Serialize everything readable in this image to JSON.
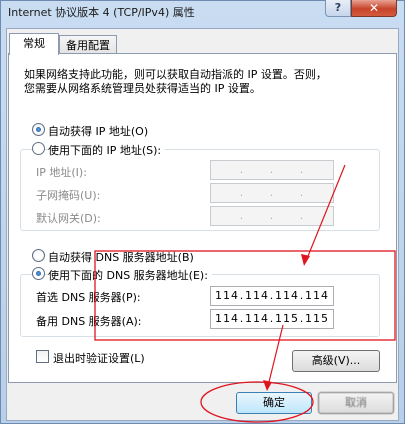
{
  "window": {
    "title": "Internet 协议版本 4 (TCP/IPv4) 属性",
    "help_label": "?",
    "close_label": "✕"
  },
  "tabs": [
    {
      "label": "常规",
      "active": true
    },
    {
      "label": "备用配置",
      "active": false
    }
  ],
  "description": {
    "line1": "如果网络支持此功能，则可以获取自动指派的 IP 设置。否则，",
    "line2": "您需要从网络系统管理员处获得适当的 IP 设置。"
  },
  "ip": {
    "auto_label": "自动获得 IP 地址(O)",
    "manual_label": "使用下面的 IP 地址(S):",
    "selected": "auto",
    "fields": [
      {
        "label": "IP 地址(I):",
        "segments": [
          "",
          "",
          "",
          ""
        ]
      },
      {
        "label": "子网掩码(U):",
        "segments": [
          "",
          "",
          "",
          ""
        ]
      },
      {
        "label": "默认网关(D):",
        "segments": [
          "",
          "",
          "",
          ""
        ]
      }
    ]
  },
  "dns": {
    "auto_label": "自动获得 DNS 服务器地址(B)",
    "manual_label": "使用下面的 DNS 服务器地址(E):",
    "selected": "manual",
    "fields": [
      {
        "label": "首选 DNS 服务器(P):",
        "segments": [
          "114",
          "114",
          "114",
          "114"
        ]
      },
      {
        "label": "备用 DNS 服务器(A):",
        "segments": [
          "114",
          "114",
          "115",
          "115"
        ]
      }
    ]
  },
  "validate": {
    "label": "退出时验证设置(L)",
    "checked": false
  },
  "advanced_button": "高级(V)...",
  "ok_button": "确定",
  "cancel_button": "取消",
  "annotation_color": "#e0141e"
}
